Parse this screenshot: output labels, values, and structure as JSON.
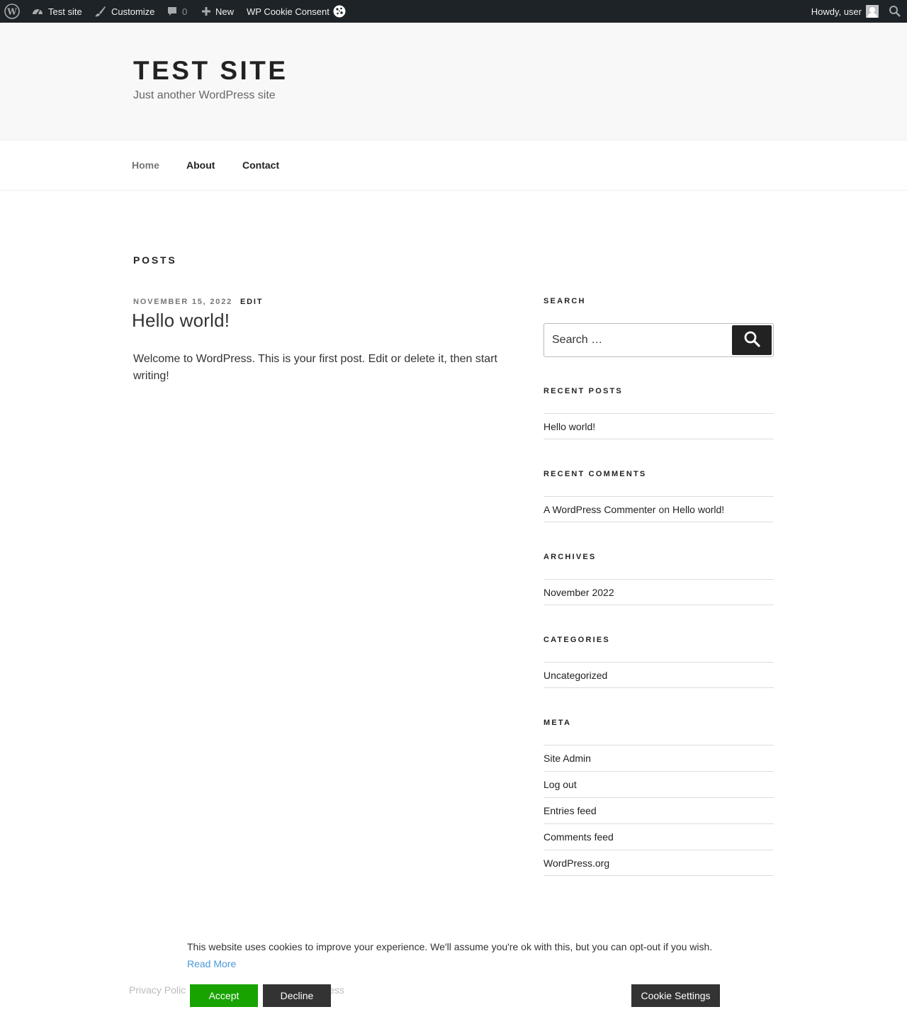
{
  "admin_bar": {
    "site_name": "Test site",
    "customize": "Customize",
    "comments_count": "0",
    "new": "New",
    "plugin": "WP Cookie Consent",
    "howdy": "Howdy, user"
  },
  "header": {
    "title": "TEST SITE",
    "description": "Just another WordPress site"
  },
  "nav": {
    "home": "Home",
    "about": "About",
    "contact": "Contact"
  },
  "main": {
    "heading": "POSTS",
    "post": {
      "date": "NOVEMBER 15, 2022",
      "edit": "EDIT",
      "title": "Hello world!",
      "body": "Welcome to WordPress. This is your first post. Edit or delete it, then start writing!"
    }
  },
  "sidebar": {
    "search": {
      "title": "SEARCH",
      "placeholder": "Search …"
    },
    "recent_posts": {
      "title": "RECENT POSTS",
      "items": [
        "Hello world!"
      ]
    },
    "recent_comments": {
      "title": "RECENT COMMENTS",
      "author": "A WordPress Commenter",
      "on": "on",
      "post": "Hello world!"
    },
    "archives": {
      "title": "ARCHIVES",
      "items": [
        "November 2022"
      ]
    },
    "categories": {
      "title": "CATEGORIES",
      "items": [
        "Uncategorized"
      ]
    },
    "meta": {
      "title": "META",
      "items": [
        "Site Admin",
        "Log out",
        "Entries feed",
        "Comments feed",
        "WordPress.org"
      ]
    }
  },
  "footer": {
    "privacy": "Privacy Polic",
    "powered": "ess"
  },
  "cookie_banner": {
    "text": "This website uses cookies to improve your experience. We'll assume you're ok with this, but you can opt-out if you wish.",
    "read_more": "Read More",
    "accept": "Accept",
    "decline": "Decline",
    "settings": "Cookie Settings",
    "accept_color": "#18a300"
  }
}
